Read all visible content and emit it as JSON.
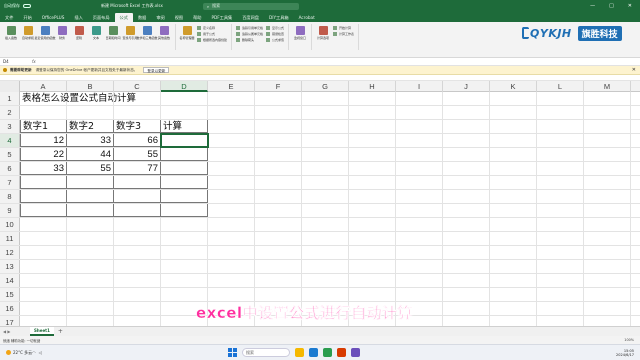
{
  "titlebar": {
    "autosave": "自动保存",
    "doc_title": "新建 Microsoft Excel 工作表.xlsx",
    "search_placeholder": "搜索",
    "min": "—",
    "max": "□",
    "close": "✕"
  },
  "menu": [
    "文件",
    "开始",
    "OfficePLUS",
    "插入",
    "页面布局",
    "公式",
    "数据",
    "审阅",
    "视图",
    "帮助",
    "PDF工具集",
    "百度网盘",
    "DIY工具箱",
    "Acrobat"
  ],
  "menu_active": 5,
  "ribbon": {
    "groups": [
      {
        "buttons": [
          "插入函数",
          "自动求和",
          "最近使用的函数",
          "财务",
          "逻辑",
          "文本",
          "日期和时间",
          "查找与引用",
          "数学和三角函数",
          "其他函数"
        ],
        "caption": "函数库"
      },
      {
        "buttons": [
          "名称管理器"
        ],
        "small": [
          "定义名称",
          "用于公式",
          "根据所选内容创建"
        ],
        "caption": "定义的名称"
      },
      {
        "small": [
          "追踪引用单元格",
          "追踪从属单元格",
          "删除箭头"
        ],
        "small2": [
          "显示公式",
          "错误检查",
          "公式求值"
        ],
        "caption": "公式审核"
      },
      {
        "buttons": [
          "监视窗口"
        ],
        "caption": ""
      },
      {
        "buttons": [
          "计算选项"
        ],
        "small": [
          "开始计算",
          "计算工作表"
        ],
        "caption": "计算"
      }
    ]
  },
  "logo": {
    "latin": "QYKJH",
    "cn": "旗胜科技"
  },
  "namebar": {
    "cell": "D4",
    "fx": "fx"
  },
  "infobar": {
    "title": "需要帮助更新",
    "text": "请登录以保持您的 OneDrive 帐户更新并且文档处于最新状态。",
    "button": "登录以更新",
    "close": "✕"
  },
  "sheet": {
    "columns": [
      "A",
      "B",
      "C",
      "D",
      "E",
      "F",
      "G",
      "H",
      "I",
      "J",
      "K",
      "L",
      "M"
    ],
    "row_numbers": [
      "1",
      "2",
      "3",
      "4",
      "5",
      "6",
      "7",
      "8",
      "9",
      "10",
      "11",
      "12",
      "13",
      "14",
      "15",
      "16",
      "17"
    ],
    "a1": "表格怎么设置公式自动计算",
    "headers": [
      "数字1",
      "数字2",
      "数字3",
      "计算"
    ],
    "data": [
      [
        "12",
        "33",
        "66",
        ""
      ],
      [
        "22",
        "44",
        "55",
        ""
      ],
      [
        "33",
        "55",
        "77",
        ""
      ]
    ],
    "active_cell": "D4"
  },
  "caption": "excel中设置公式进行自动计算",
  "sheetbar": {
    "nav": "◀ ▶",
    "tab": "Sheet1",
    "add": "+"
  },
  "statusbar": {
    "left": "就绪  辅助功能: 一切就绪",
    "zoom": "100%"
  },
  "taskbar": {
    "weather": "22°C 多云",
    "search": "搜索",
    "time": "15:05",
    "date": "2024/6/17"
  }
}
